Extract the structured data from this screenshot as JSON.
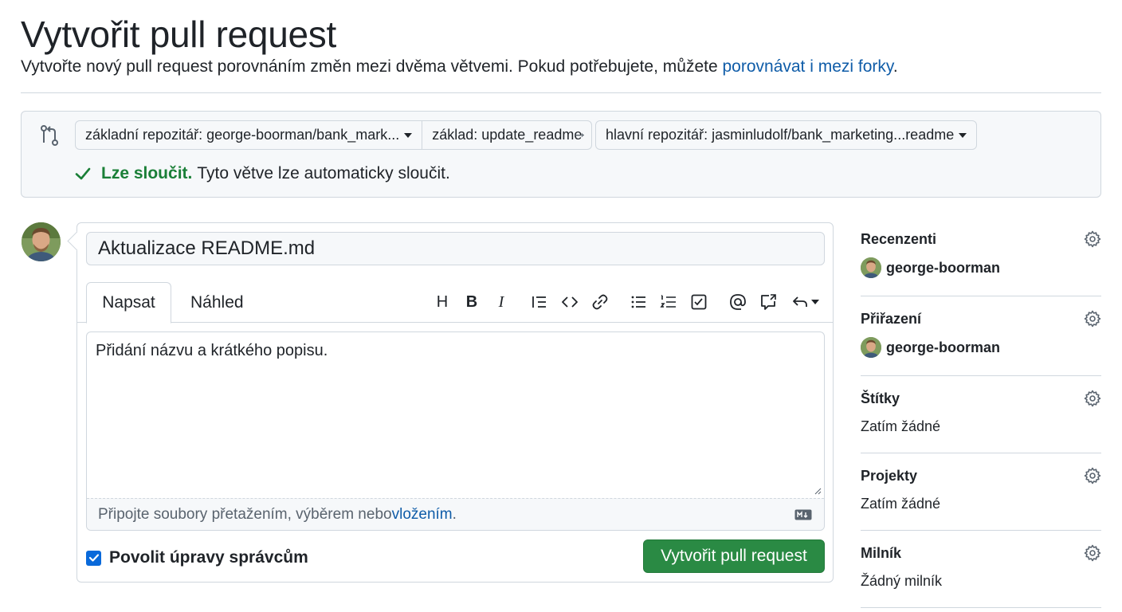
{
  "header": {
    "title": "Vytvořit pull request",
    "subtitle_text": "Vytvořte nový pull request porovnáním změn mezi dvěma větvemi. Pokud potřebujete, můžete ",
    "subtitle_link": "porovnávat i mezi forky",
    "subtitle_end": "."
  },
  "compare": {
    "base_repo": "základní repozitář: george-boorman/bank_mark...",
    "base_branch": "základ: update_readme",
    "arrow": "→",
    "head_repo": "hlavní repozitář: jasminludolf/bank_marketing...readme",
    "merge_ok": "Lze sloučit.",
    "merge_text": "Tyto větve lze automaticky sloučit."
  },
  "form": {
    "title_value": "Aktualizace README.md",
    "tabs": [
      {
        "label": "Napsat"
      },
      {
        "label": "Náhled"
      }
    ],
    "toolbar": {
      "heading": "H",
      "bold": "B",
      "italic": "I"
    },
    "body_value": "Přidání názvu a krátkého popisu.",
    "attach_text": "Připojte soubory přetažením, výběrem nebo ",
    "attach_link": "vložením",
    "attach_end": ".",
    "allow_edits_label": "Povolit úpravy správcům",
    "submit_label": "Vytvořit pull request"
  },
  "sidebar": {
    "reviewers": {
      "heading": "Recenzenti",
      "user": "george-boorman"
    },
    "assignees": {
      "heading": "Přiřazení",
      "user": "george-boorman"
    },
    "labels": {
      "heading": "Štítky",
      "value": "Zatím žádné"
    },
    "projects": {
      "heading": "Projekty",
      "value": "Zatím žádné"
    },
    "milestone": {
      "heading": "Milník",
      "value": "Žádný milník"
    }
  },
  "colors": {
    "primary_button": "#2a8a44",
    "link": "#0f5ca8",
    "success": "#1a7f37",
    "border": "#d0d7de"
  }
}
